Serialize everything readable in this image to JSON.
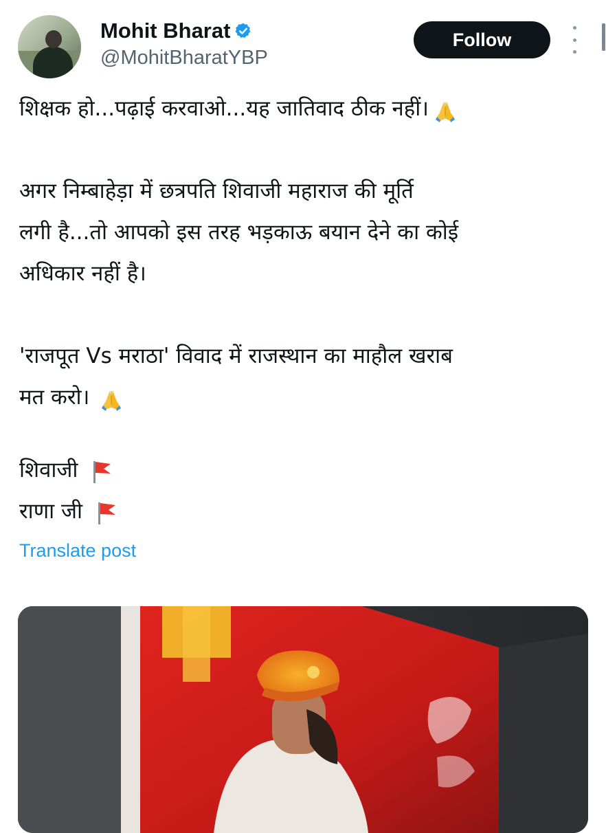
{
  "author": {
    "name": "Mohit Bharat",
    "handle": "@MohitBharatYBP",
    "verified_color": "#1d9bf0"
  },
  "actions": {
    "follow_label": "Follow"
  },
  "post": {
    "lines": [
      "शिक्षक हो...पढ़ाई करवाओ...यह जातिवाद ठीक नहीं।",
      "अगर निम्बाहेड़ा में छत्रपति शिवाजी महाराज की मूर्ति",
      "लगी है...तो आपको इस तरह भड़काऊ बयान देने का कोई",
      "अधिकार नहीं है।",
      "'राजपूत Vs मराठा' विवाद में राजस्थान का माहौल खराब",
      "मत करो।",
      "शिवाजी",
      "राणा जी"
    ],
    "translate_label": "Translate post"
  },
  "icons": {
    "verified": "verified-badge-icon",
    "more": "more-options-icon",
    "pray": "folded-hands-emoji",
    "flag": "triangular-flag-emoji"
  },
  "colors": {
    "accent": "#1d9bf0",
    "text": "#0f1419",
    "muted": "#536471"
  }
}
